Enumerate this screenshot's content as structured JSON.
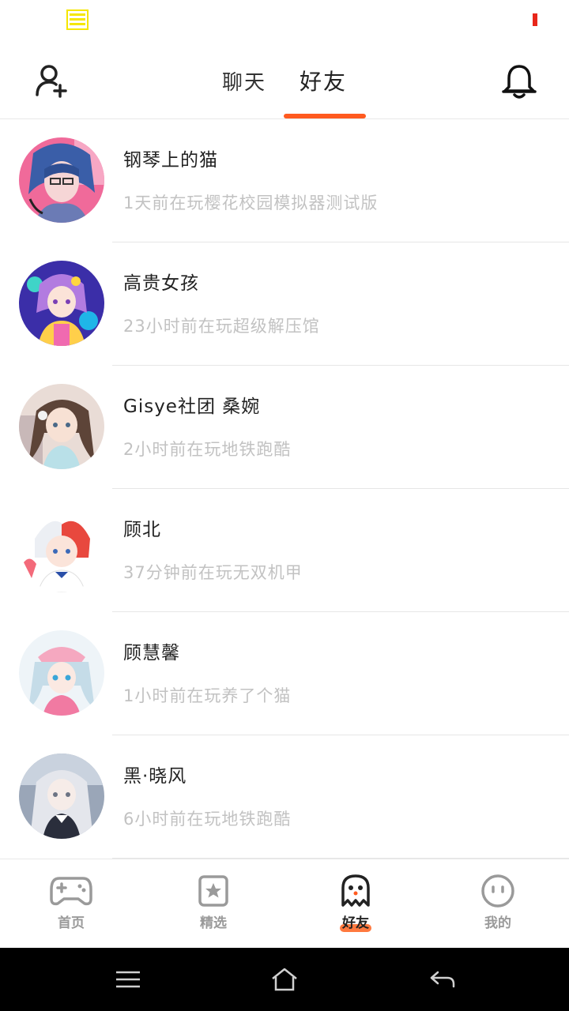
{
  "colors": {
    "accent": "#ff5a1f",
    "name_text": "#222222",
    "status_text": "#c2c2c2",
    "status_menu_icon": "#f5e600",
    "battery_indicator": "#e8261a"
  },
  "status_bar": {
    "left_icon": "menu-icon",
    "right_indicator": "battery-indicator"
  },
  "header": {
    "add_friend_icon": "add-user-icon",
    "tabs": [
      {
        "label": "聊天",
        "active": false
      },
      {
        "label": "好友",
        "active": true
      }
    ],
    "notification_icon": "bell-icon"
  },
  "friends": [
    {
      "name": "钢琴上的猫",
      "status": "1天前在玩樱花校园模拟器测试版"
    },
    {
      "name": "高贵女孩",
      "status": "23小时前在玩超级解压馆"
    },
    {
      "name": "Gisye社团 桑婉",
      "status": "2小时前在玩地铁跑酷"
    },
    {
      "name": "顾北",
      "status": "37分钟前在玩无双机甲"
    },
    {
      "name": "顾慧馨",
      "status": "1小时前在玩养了个猫"
    },
    {
      "name": "黑·晓风",
      "status": "6小时前在玩地铁跑酷"
    }
  ],
  "bottom_nav": [
    {
      "label": "首页",
      "icon": "gamepad-icon",
      "active": false
    },
    {
      "label": "精选",
      "icon": "star-badge-icon",
      "active": false
    },
    {
      "label": "好友",
      "icon": "ghost-icon",
      "active": true
    },
    {
      "label": "我的",
      "icon": "face-icon",
      "active": false
    }
  ],
  "system_nav": {
    "menu": "menu-lines-icon",
    "home": "home-icon",
    "back": "back-arrow-icon"
  }
}
